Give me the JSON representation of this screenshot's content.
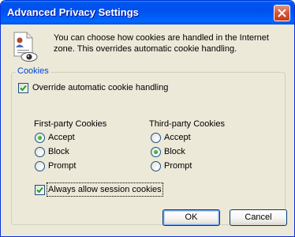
{
  "window": {
    "title": "Advanced Privacy Settings"
  },
  "intro": {
    "line1": "You can choose how cookies are handled in the Internet",
    "line2": "zone.  This overrides automatic cookie handling."
  },
  "cookies": {
    "group_label": "Cookies",
    "override": {
      "label": "Override automatic cookie handling",
      "checked": true
    },
    "first_party": {
      "heading": "First-party Cookies",
      "options": [
        "Accept",
        "Block",
        "Prompt"
      ],
      "selected": "Accept"
    },
    "third_party": {
      "heading": "Third-party Cookies",
      "options": [
        "Accept",
        "Block",
        "Prompt"
      ],
      "selected": "Block"
    },
    "session": {
      "label": "Always allow session cookies",
      "checked": true
    }
  },
  "buttons": {
    "ok": "OK",
    "cancel": "Cancel"
  },
  "colors": {
    "titlebar": "#0053ee",
    "group_label": "#0046d5",
    "radio_dot": "#21a121",
    "close_button": "#d85a3e"
  },
  "icons": [
    "close-icon",
    "privacy-document-icon",
    "checkmark-icon",
    "radio-dot-icon"
  ]
}
